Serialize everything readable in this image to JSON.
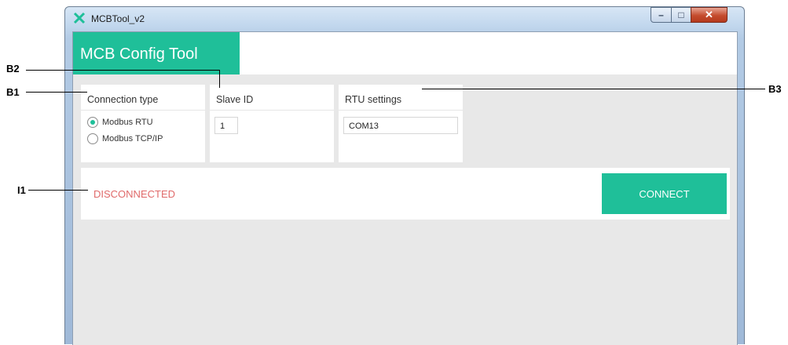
{
  "window": {
    "title": "MCBTool_v2",
    "controls": {
      "minimize": "–",
      "maximize": "□",
      "close": "✕"
    }
  },
  "app": {
    "title": "MCB Config Tool"
  },
  "panels": {
    "connection": {
      "title": "Connection type",
      "options": [
        {
          "label": "Modbus RTU",
          "selected": true
        },
        {
          "label": "Modbus TCP/IP",
          "selected": false
        }
      ]
    },
    "slave": {
      "title": "Slave ID",
      "value": "1"
    },
    "rtu": {
      "title": "RTU settings",
      "value": "COM13"
    }
  },
  "status": {
    "text": "DISCONNECTED",
    "color": "#e06a6a"
  },
  "connect_button": {
    "label": "CONNECT"
  },
  "callouts": {
    "b1": "B1",
    "b2": "B2",
    "b3": "B3",
    "i1": "I1"
  },
  "colors": {
    "accent": "#1fbf99",
    "background": "#e8e8e8"
  },
  "icons": {
    "app": "mcb-tool-logo-icon"
  }
}
